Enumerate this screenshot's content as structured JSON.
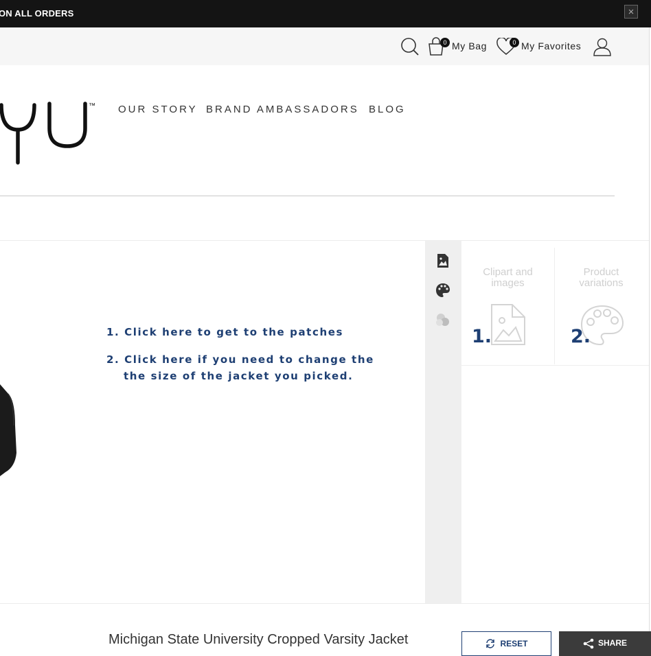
{
  "announcement": {
    "text": "ON ALL ORDERS",
    "close_symbol": "×"
  },
  "utility": {
    "bag": {
      "label": "My Bag",
      "count": "0"
    },
    "favorites": {
      "label": "My Favorites",
      "count": "0"
    }
  },
  "brand": {
    "logo_text": "yu",
    "trademark": "™"
  },
  "nav": {
    "items": [
      {
        "label": "OUR STORY"
      },
      {
        "label": "BRAND AMBASSADORS"
      },
      {
        "label": "BLOG"
      }
    ]
  },
  "instructions": {
    "line1": "1. Click here to get to the patches",
    "line2a": "2. Click here if you need to change the",
    "line2b": "the size of the jacket you picked."
  },
  "designer_panel": {
    "tiles": [
      {
        "label_line1": "Clipart and",
        "label_line2": "images",
        "annotation": "1."
      },
      {
        "label_line1": "Product",
        "label_line2": "variations",
        "annotation": "2."
      }
    ]
  },
  "product": {
    "title": "Michigan State University Cropped Varsity Jacket"
  },
  "actions": {
    "reset_label": "RESET",
    "share_label": "SHARE"
  },
  "colors": {
    "accent": "#1e3f73",
    "dark_bar": "#141414",
    "utility_bg": "#f6f6f6",
    "toolbar_bg": "#efefef"
  }
}
